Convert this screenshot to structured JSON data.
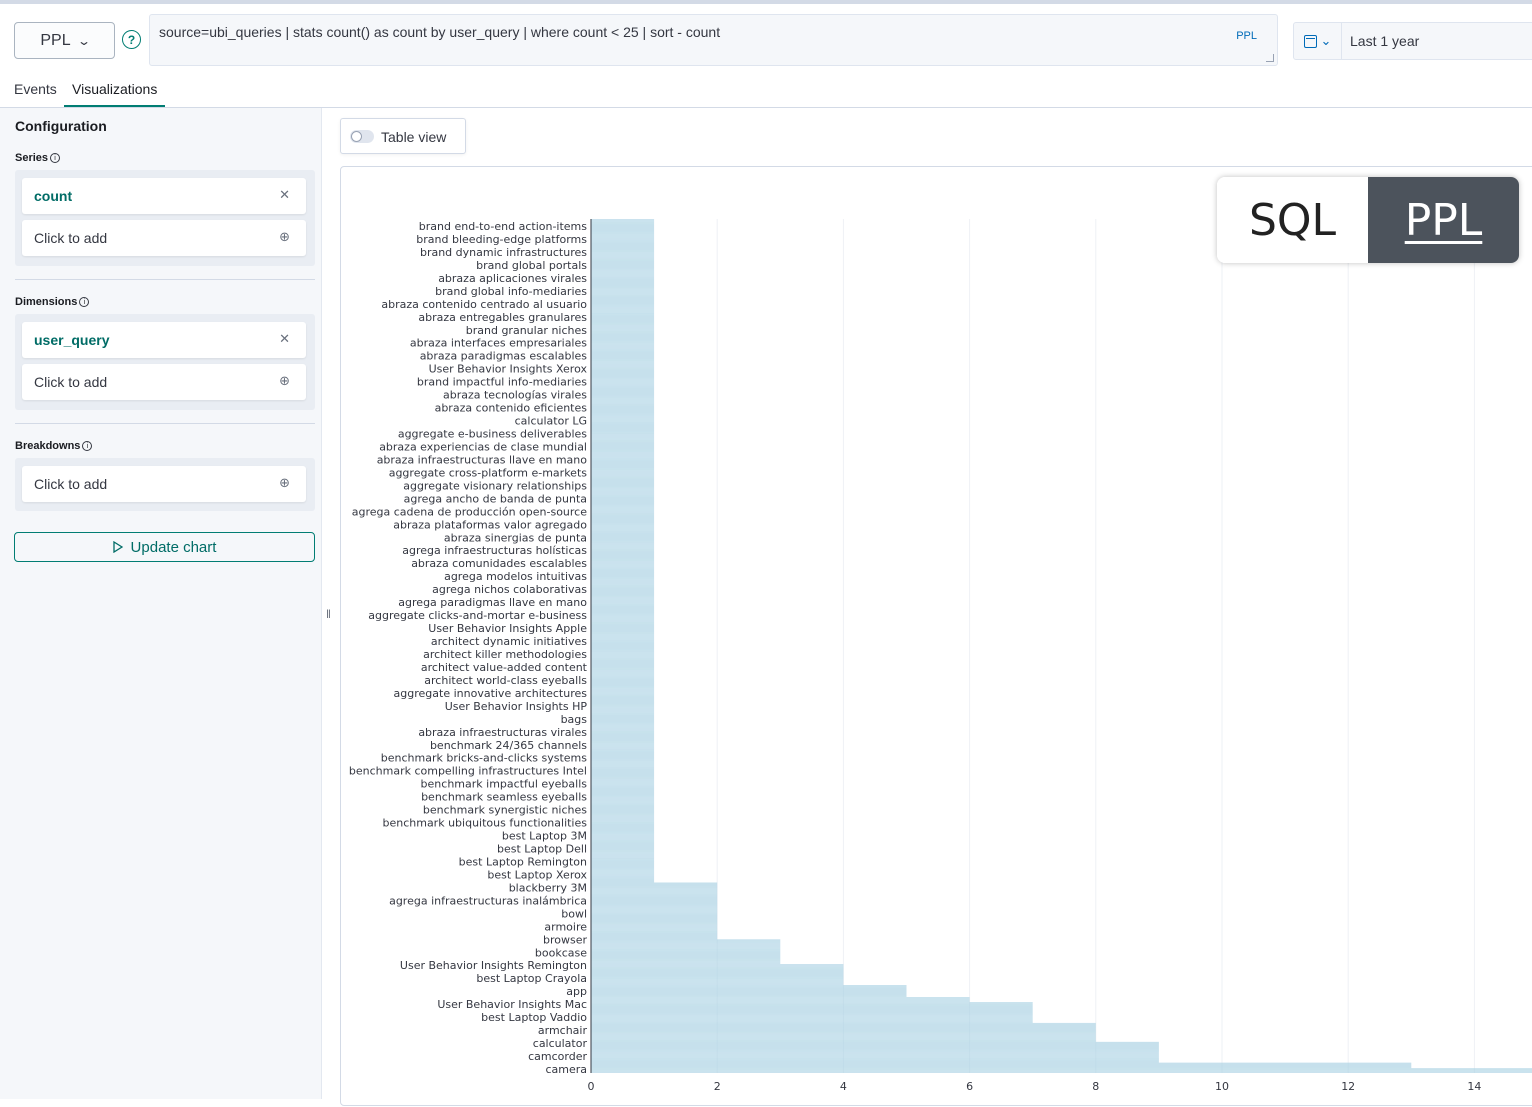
{
  "toolbar": {
    "language": "PPL",
    "query": "source=ubi_queries | stats count() as count by user_query | where count < 25 | sort - count",
    "query_badge": "PPL",
    "date_range": "Last 1 year"
  },
  "tabs": [
    {
      "label": "Events"
    },
    {
      "label": "Visualizations"
    }
  ],
  "sidebar": {
    "title": "Configuration",
    "series_label": "Series",
    "series_field": "count",
    "series_add": "Click to add",
    "dimensions_label": "Dimensions",
    "dimensions_field": "user_query",
    "dimensions_add": "Click to add",
    "breakdowns_label": "Breakdowns",
    "breakdowns_add": "Click to add",
    "update_button": "Update chart"
  },
  "table_view_label": "Table view",
  "overlay": {
    "left": "SQL",
    "right": "PPL"
  },
  "colors": {
    "bar": "#a9d1e3",
    "accent": "#017d73",
    "link": "#006bb8"
  },
  "chart_data": {
    "type": "bar",
    "orientation": "horizontal",
    "xlim": [
      0,
      15
    ],
    "xticks": [
      0,
      2,
      4,
      6,
      8,
      10,
      12,
      14
    ],
    "categories": [
      "brand end-to-end action-items",
      "brand bleeding-edge platforms",
      "brand dynamic infrastructures",
      "brand global portals",
      "abraza aplicaciones virales",
      "brand global info-mediaries",
      "abraza contenido centrado al usuario",
      "abraza entregables granulares",
      "brand granular niches",
      "abraza interfaces empresariales",
      "abraza paradigmas escalables",
      "User Behavior Insights Xerox",
      "brand impactful info-mediaries",
      "abraza tecnologías virales",
      "abraza contenido eficientes",
      "calculator LG",
      "aggregate e-business deliverables",
      "abraza experiencias de clase mundial",
      "abraza infraestructuras llave en mano",
      "aggregate cross-platform e-markets",
      "aggregate visionary relationships",
      "agrega ancho de banda de punta",
      "agrega cadena de producción open-source",
      "abraza plataformas valor agregado",
      "abraza sinergias de punta",
      "agrega infraestructuras holísticas",
      "abraza comunidades escalables",
      "agrega modelos intuitivas",
      "agrega nichos colaborativas",
      "agrega paradigmas llave en mano",
      "aggregate clicks-and-mortar e-business",
      "User Behavior Insights Apple",
      "architect dynamic initiatives",
      "architect killer methodologies",
      "architect value-added content",
      "architect world-class eyeballs",
      "aggregate innovative architectures",
      "User Behavior Insights HP",
      "bags",
      "abraza infraestructuras virales",
      "benchmark 24/365 channels",
      "benchmark bricks-and-clicks systems",
      "benchmark compelling infrastructures Intel",
      "benchmark impactful eyeballs",
      "benchmark seamless eyeballs",
      "benchmark synergistic niches",
      "benchmark ubiquitous functionalities",
      "best Laptop 3M",
      "best Laptop Dell",
      "best Laptop Remington",
      "best Laptop Xerox",
      "blackberry 3M",
      "agrega infraestructuras inalámbrica",
      "bowl",
      "armoire",
      "browser",
      "bookcase",
      "User Behavior Insights Remington",
      "best Laptop Crayola",
      "app",
      "User Behavior Insights Mac",
      "best Laptop Vaddio",
      "armchair",
      "calculator",
      "camcorder",
      "camera"
    ],
    "bar_rows": [
      1,
      1,
      1,
      1,
      1,
      1,
      1,
      1,
      1,
      1,
      1,
      1,
      1,
      1,
      1,
      1,
      1,
      1,
      1,
      1,
      1,
      1,
      1,
      1,
      1,
      1,
      1,
      1,
      1,
      1,
      1,
      1,
      1,
      1,
      1,
      1,
      1,
      1,
      1,
      1,
      1,
      1,
      1,
      1,
      1,
      1,
      1,
      1,
      1,
      1,
      1,
      1,
      1,
      1,
      1,
      1,
      1,
      1,
      1,
      1,
      1,
      1,
      1,
      1,
      1,
      1,
      1,
      1,
      1,
      1,
      1,
      1,
      1,
      1,
      1,
      1,
      1,
      1,
      1,
      1,
      1,
      1,
      1,
      1,
      1,
      1,
      1,
      1,
      1,
      1,
      1,
      1,
      1,
      1,
      1,
      1,
      1,
      1,
      1,
      1,
      1,
      1,
      1,
      1,
      1,
      1,
      1,
      1,
      1,
      1,
      1,
      1,
      1,
      1,
      1,
      1,
      1,
      1,
      1,
      1,
      1,
      1,
      1,
      1,
      1,
      1,
      1,
      1,
      1,
      1,
      1,
      1,
      1,
      1,
      1,
      1,
      1,
      1,
      1,
      1,
      1,
      1,
      1,
      1,
      1,
      1,
      1,
      1,
      1,
      1,
      1,
      1,
      1,
      1,
      1,
      1,
      1,
      1,
      1,
      1,
      1,
      1,
      1,
      1,
      1,
      1,
      1,
      1,
      1,
      1,
      1,
      1,
      1,
      1,
      1,
      1,
      1,
      1,
      1,
      1,
      1,
      1,
      1,
      1,
      1,
      1,
      1,
      1,
      1,
      1,
      1,
      1,
      1,
      1,
      1,
      1,
      1,
      1,
      1,
      1,
      1,
      1,
      1,
      1,
      1,
      1,
      1,
      1,
      1,
      1,
      1,
      1,
      1,
      1,
      1,
      1,
      1,
      1,
      1,
      1,
      1,
      1,
      1,
      1,
      1,
      1,
      1,
      1,
      1,
      1,
      1,
      1,
      1,
      1,
      1,
      1,
      1,
      1,
      1,
      1,
      1,
      1,
      1,
      1,
      1,
      1,
      1,
      1,
      1,
      1,
      1,
      1,
      1,
      1,
      1,
      1,
      1,
      1,
      1,
      1,
      1,
      1,
      1,
      1,
      1,
      1,
      1,
      1,
      1,
      1,
      1,
      1,
      1,
      1,
      1,
      1,
      1,
      1,
      1,
      1,
      1,
      1,
      1,
      1,
      1,
      1,
      1,
      1,
      1,
      1,
      1,
      1,
      1,
      1,
      1,
      1,
      1,
      1,
      1,
      1,
      1,
      1,
      1,
      1,
      1,
      1,
      1,
      1,
      1,
      1,
      1,
      1,
      1,
      1,
      1,
      1,
      1,
      1,
      1,
      1,
      1,
      1,
      1,
      1,
      1,
      1,
      1,
      1,
      1,
      1,
      1,
      1,
      1,
      1,
      1,
      1,
      1,
      1,
      1,
      1,
      1,
      1,
      1,
      1,
      1,
      1,
      1,
      1,
      1,
      1,
      1,
      1,
      1,
      1,
      1,
      1,
      1,
      1,
      1,
      1,
      1,
      1,
      1,
      1,
      1,
      1,
      1,
      1,
      1,
      1,
      1,
      1,
      1,
      1,
      1,
      1,
      1,
      1,
      1,
      1,
      1,
      1,
      1,
      1,
      1,
      1,
      1,
      1,
      1,
      1,
      1,
      1,
      1,
      1,
      1,
      1,
      1,
      1,
      1,
      1,
      1,
      1,
      1,
      1,
      1,
      1,
      1,
      1,
      1,
      1,
      1,
      1,
      1,
      1,
      1,
      1,
      1,
      1,
      1,
      1,
      1,
      1,
      1,
      1,
      1,
      1,
      1,
      1,
      1,
      1,
      1,
      1,
      1,
      1,
      1,
      1,
      1,
      1,
      1,
      1,
      1,
      1,
      1,
      1,
      1,
      1,
      1,
      1,
      1,
      1,
      1,
      1,
      1,
      1,
      1,
      1,
      1,
      1,
      1,
      1,
      1,
      1,
      1,
      1,
      1,
      1,
      1,
      1,
      1,
      1,
      1,
      1,
      1,
      1,
      1,
      1,
      1,
      1,
      1,
      1,
      1,
      1,
      1,
      1,
      1,
      1,
      1,
      1,
      1,
      1,
      1,
      1,
      1,
      1,
      1,
      1,
      1,
      1,
      1,
      1,
      1,
      1,
      1,
      1,
      1,
      1,
      1,
      1,
      1,
      1,
      1,
      1,
      1,
      1,
      1,
      1,
      1,
      1,
      1,
      1,
      1,
      1,
      1,
      1,
      1,
      1,
      1,
      1,
      1,
      1,
      1,
      1,
      1,
      1,
      1,
      1,
      1,
      1,
      1,
      1,
      1,
      1,
      1,
      1,
      1,
      1,
      1,
      1,
      1,
      1,
      1,
      1,
      1,
      1,
      1,
      1,
      1,
      1,
      1,
      1,
      1,
      1,
      1,
      1,
      1,
      1,
      1,
      1,
      1,
      1,
      1,
      1,
      1,
      1,
      1,
      1,
      1,
      1,
      1,
      1,
      1,
      1,
      1,
      1,
      1,
      1,
      1,
      1,
      1,
      1,
      1,
      1,
      1,
      1,
      1,
      1,
      1,
      1,
      1,
      1,
      1,
      1,
      1,
      1,
      1,
      1,
      1,
      1,
      1,
      1,
      1,
      1,
      1,
      1,
      1,
      1,
      1,
      1,
      1,
      1,
      1,
      1,
      1,
      1,
      1,
      1,
      1,
      1,
      1,
      1,
      1,
      1,
      1,
      1,
      1,
      1,
      1,
      1,
      1,
      1,
      1,
      1,
      1,
      1,
      1,
      1,
      1,
      1,
      1,
      1,
      1,
      1,
      1,
      1,
      1,
      1,
      1,
      1,
      1,
      1,
      1,
      1,
      1,
      1,
      1,
      1,
      1,
      1,
      1,
      1,
      1,
      1,
      1,
      1,
      1,
      1,
      1,
      1,
      1,
      1,
      1,
      1,
      1,
      1,
      1,
      1,
      1,
      1,
      1,
      1,
      1,
      1,
      1,
      1,
      1,
      1,
      1,
      1,
      1,
      1,
      2,
      2,
      2,
      2,
      2,
      2,
      2,
      2,
      2,
      2,
      2,
      2,
      2,
      2,
      2,
      2,
      2,
      2,
      2,
      2,
      2,
      2,
      2,
      2,
      2,
      2,
      2,
      2,
      2,
      2,
      2,
      2,
      2,
      2,
      2,
      2,
      2,
      2,
      2,
      2,
      2,
      2,
      2,
      2,
      2,
      2,
      2,
      2,
      2,
      2,
      2,
      2,
      2,
      2,
      2,
      2,
      2,
      2,
      2,
      2,
      3,
      3,
      3,
      3,
      3,
      3,
      3,
      3,
      3,
      3,
      3,
      3,
      3,
      3,
      3,
      3,
      3,
      3,
      3,
      3,
      3,
      3,
      3,
      3,
      3,
      3,
      4,
      4,
      4,
      4,
      4,
      4,
      4,
      4,
      4,
      4,
      4,
      4,
      4,
      4,
      4,
      4,
      4,
      4,
      4,
      4,
      4,
      4,
      5,
      5,
      5,
      5,
      5,
      5,
      5,
      5,
      5,
      5,
      5,
      5,
      5,
      6,
      6,
      6,
      6,
      6,
      7,
      7,
      7,
      7,
      7,
      7,
      7,
      7,
      7,
      7,
      7,
      7,
      7,
      7,
      7,
      7,
      7,
      7,
      7,
      7,
      7,
      7,
      8,
      8,
      8,
      8,
      8,
      8,
      8,
      8,
      8,
      8,
      8,
      8,
      8,
      8,
      8,
      8,
      8,
      8,
      8,
      8,
      9,
      9,
      9,
      9,
      9,
      9,
      9,
      9,
      9,
      9,
      9,
      9,
      9,
      9,
      9,
      9,
      9,
      9,
      9,
      9,
      9,
      9,
      13,
      13,
      13,
      13,
      13,
      13,
      15,
      15,
      15,
      15,
      15
    ]
  }
}
